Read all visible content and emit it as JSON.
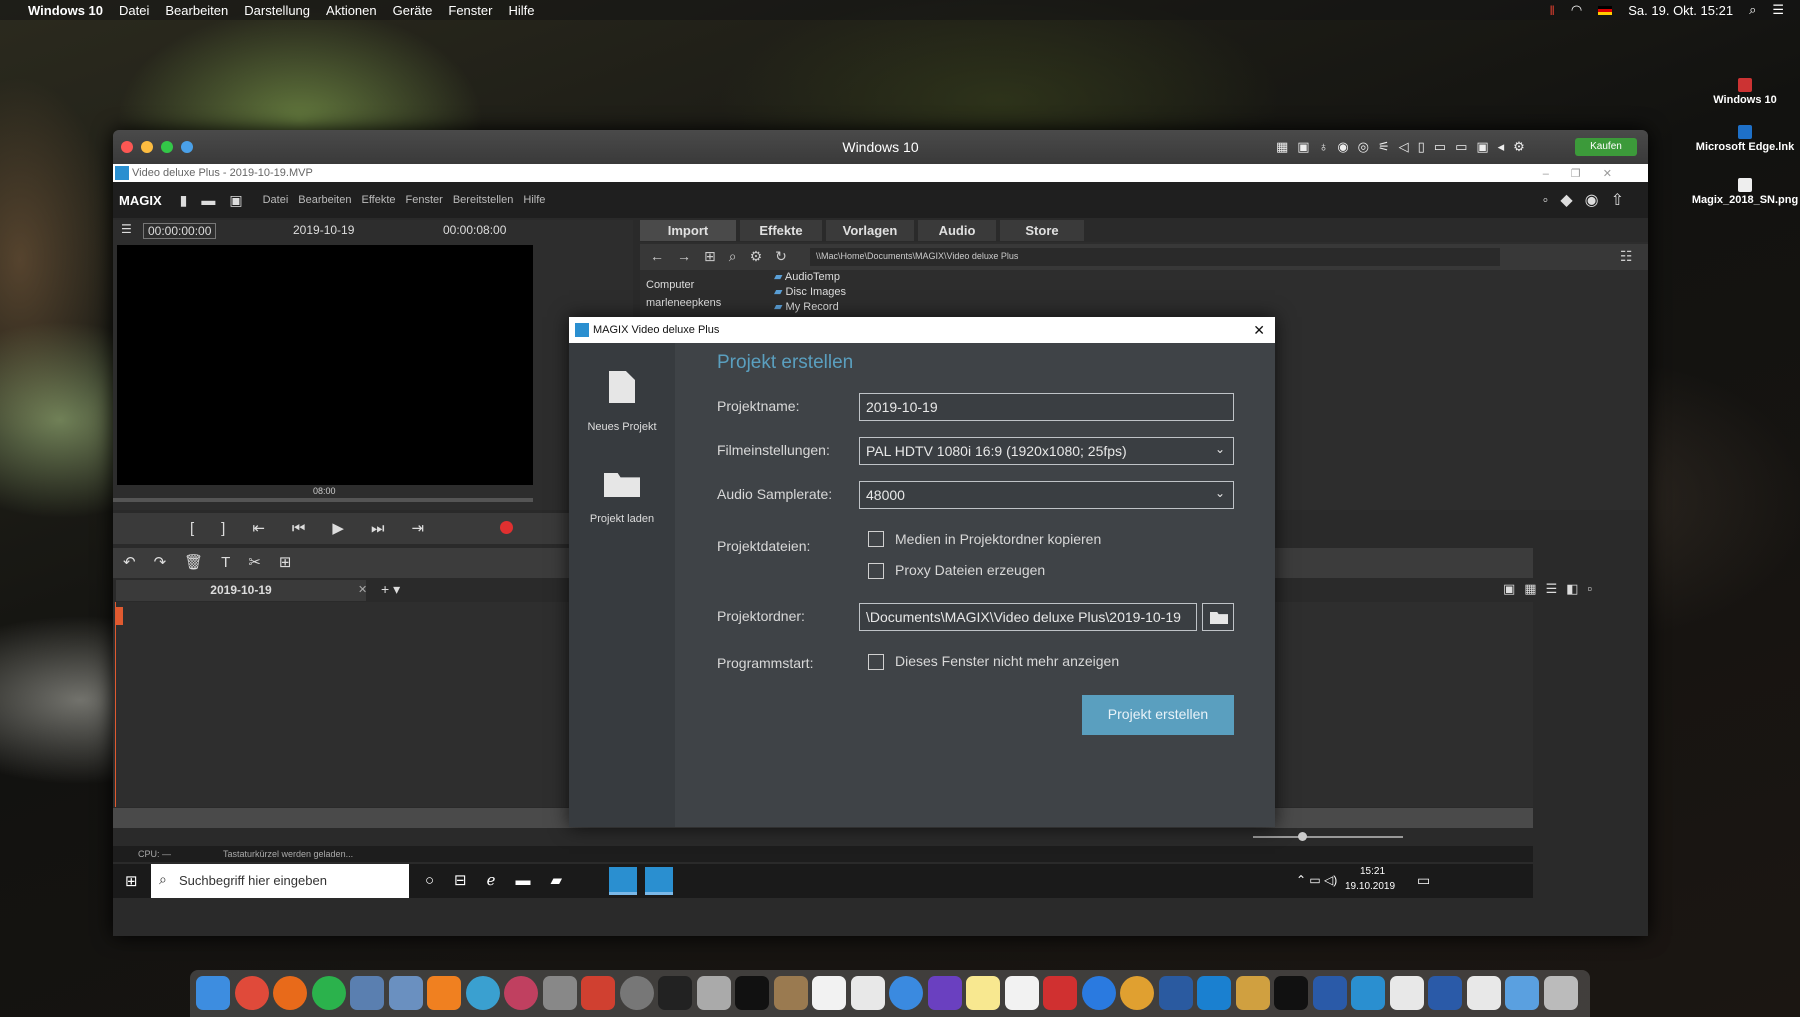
{
  "menubar": {
    "app": "Windows 10",
    "items": [
      "Datei",
      "Bearbeiten",
      "Darstellung",
      "Aktionen",
      "Geräte",
      "Fenster",
      "Hilfe"
    ],
    "clock": "Sa. 19. Okt.  15:21"
  },
  "desktop": {
    "icons": [
      "Windows 10",
      "Microsoft Edge.lnk",
      "Magix_2018_SN.png"
    ]
  },
  "parallels": {
    "title": "Windows 10",
    "buy_label": "Kaufen"
  },
  "app": {
    "window_title": "Video deluxe Plus - 2019-10-19.MVP",
    "logo": "MAGIX",
    "menu": [
      "Datei",
      "Bearbeiten",
      "Effekte",
      "Fenster",
      "Bereitstellen",
      "Hilfe"
    ]
  },
  "preview": {
    "timecode": "00:00:00:00",
    "project": "2019-10-19",
    "duration": "00:00:08:00",
    "ruler_label": "08:00"
  },
  "timeline": {
    "tab": "2019-10-19"
  },
  "media": {
    "tabs": [
      "Import",
      "Effekte",
      "Vorlagen",
      "Audio",
      "Store"
    ],
    "path": "\\\\Mac\\Home\\Documents\\MAGIX\\Video deluxe Plus",
    "tree": [
      "Computer",
      "marleneepkens"
    ],
    "folders": [
      "AudioTemp",
      "Disc Images",
      "My Record"
    ]
  },
  "status": {
    "cpu": "CPU: —",
    "msg": "Tastaturkürzel werden geladen..."
  },
  "dialog": {
    "title": "MAGIX Video deluxe Plus",
    "side": [
      {
        "label": "Neues Projekt"
      },
      {
        "label": "Projekt laden"
      }
    ],
    "heading": "Projekt erstellen",
    "projektname_label": "Projektname:",
    "projektname_value": "2019-10-19",
    "film_label": "Filmeinstellungen:",
    "film_value": "PAL HDTV 1080i 16:9 (1920x1080; 25fps)",
    "audio_label": "Audio Samplerate:",
    "audio_value": "48000",
    "dateien_label": "Projektdateien:",
    "cb1": "Medien in Projektordner kopieren",
    "cb2": "Proxy Dateien erzeugen",
    "ordner_label": "Projektordner:",
    "ordner_value": "Documents\\MAGIX\\Video deluxe Plus\\2019-10-19\\",
    "start_label": "Programmstart:",
    "cb3": "Dieses Fenster nicht mehr anzeigen",
    "button": "Projekt erstellen"
  },
  "taskbar": {
    "search_placeholder": "Suchbegriff hier eingeben",
    "time": "15:21",
    "date": "19.10.2019"
  },
  "colors": {
    "accent": "#5a9fbf",
    "dialog_bg": "#3f4347",
    "record": "#e03030"
  }
}
